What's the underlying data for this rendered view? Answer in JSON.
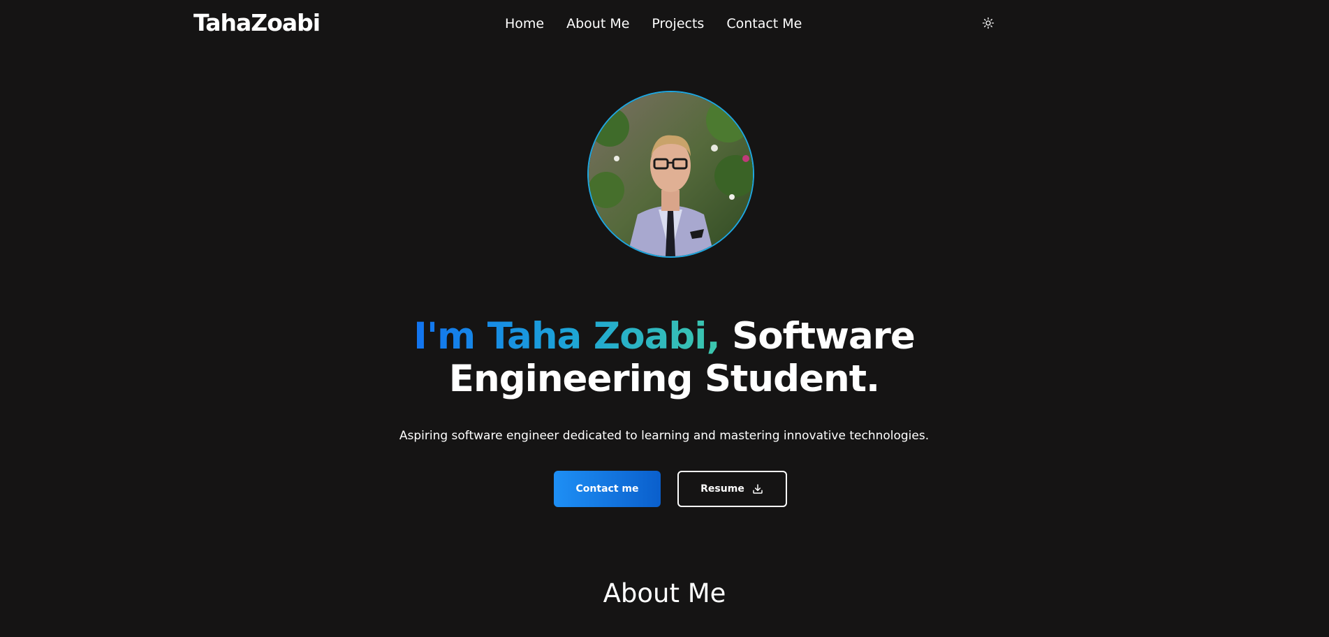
{
  "navbar": {
    "logo": "TahaZoabi",
    "links": [
      {
        "label": "Home"
      },
      {
        "label": "About Me"
      },
      {
        "label": "Projects"
      },
      {
        "label": "Contact Me"
      }
    ],
    "theme_toggle_icon": "sun-icon"
  },
  "hero": {
    "avatar_alt": "Taha Zoabi",
    "title_highlight": "I'm Taha Zoabi,",
    "title_rest": " Software Engineering Student.",
    "subtitle": "Aspiring software engineer dedicated to learning and mastering innovative technologies.",
    "contact_button": "Contact me",
    "resume_button": "Resume",
    "resume_icon": "download-icon",
    "gradient_colors": [
      "#1273f0",
      "#1da4d8",
      "#3dc7ac"
    ]
  },
  "sections": {
    "about_heading": "About Me"
  },
  "colors": {
    "background": "#151414",
    "text": "#ffffff",
    "accent": "#1e8ff5",
    "avatar_border": "#1fa7e0"
  }
}
